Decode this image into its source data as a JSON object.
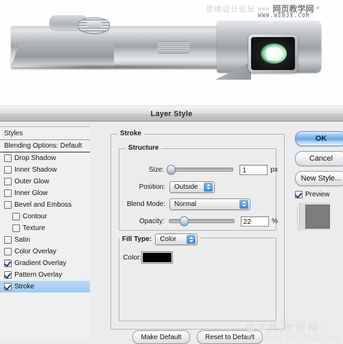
{
  "photo": {
    "alt_description": "silver digital camera body with lens and speaker grille",
    "colors": {
      "body_silver": "#c3c7ca",
      "lens_dark": "#121514",
      "lens_glow": "#8fd9a6"
    }
  },
  "watermarks": {
    "top_forum": "思缘设计论坛",
    "top_www": "www",
    "top_site": "网页教学网",
    "top_suffix": "M",
    "top_url": "WWW.WEBJX.COM",
    "bottom_site": "查字典",
    "bottom_box": "教程网",
    "bottom_url": "jiaocheng.chazidian.com"
  },
  "dialog": {
    "title": "Layer Style",
    "sidebar": {
      "header": "Styles",
      "blending_option": "Blending Options: Default",
      "items": [
        {
          "label": "Drop Shadow",
          "checked": false,
          "indent": false,
          "selected": false
        },
        {
          "label": "Inner Shadow",
          "checked": false,
          "indent": false,
          "selected": false
        },
        {
          "label": "Outer Glow",
          "checked": false,
          "indent": false,
          "selected": false
        },
        {
          "label": "Inner Glow",
          "checked": false,
          "indent": false,
          "selected": false
        },
        {
          "label": "Bevel and Emboss",
          "checked": false,
          "indent": false,
          "selected": false
        },
        {
          "label": "Contour",
          "checked": false,
          "indent": true,
          "selected": false
        },
        {
          "label": "Texture",
          "checked": false,
          "indent": true,
          "selected": false
        },
        {
          "label": "Satin",
          "checked": false,
          "indent": false,
          "selected": false
        },
        {
          "label": "Color Overlay",
          "checked": false,
          "indent": false,
          "selected": false
        },
        {
          "label": "Gradient Overlay",
          "checked": true,
          "indent": false,
          "selected": false
        },
        {
          "label": "Pattern Overlay",
          "checked": true,
          "indent": false,
          "selected": false
        },
        {
          "label": "Stroke",
          "checked": true,
          "indent": false,
          "selected": true
        }
      ]
    },
    "stroke_panel": {
      "legend": "Stroke",
      "structure": {
        "legend": "Structure",
        "size_label": "Size:",
        "size_value": "1",
        "size_unit": "px",
        "size_percent": 2,
        "position_label": "Position:",
        "position_value": "Outside",
        "blend_mode_label": "Blend Mode:",
        "blend_mode_value": "Normal",
        "opacity_label": "Opacity:",
        "opacity_value": "22",
        "opacity_unit": "%",
        "opacity_percent": 22
      },
      "fill": {
        "fill_type_label": "Fill Type:",
        "fill_type_value": "Color",
        "color_label": "Color:",
        "color_value": "#000000"
      }
    },
    "buttons": {
      "ok": "OK",
      "cancel": "Cancel",
      "new_style": "New Style...",
      "preview_label": "Preview",
      "preview_checked": true,
      "make_default": "Make Default",
      "reset_to_default": "Reset to Default"
    }
  }
}
